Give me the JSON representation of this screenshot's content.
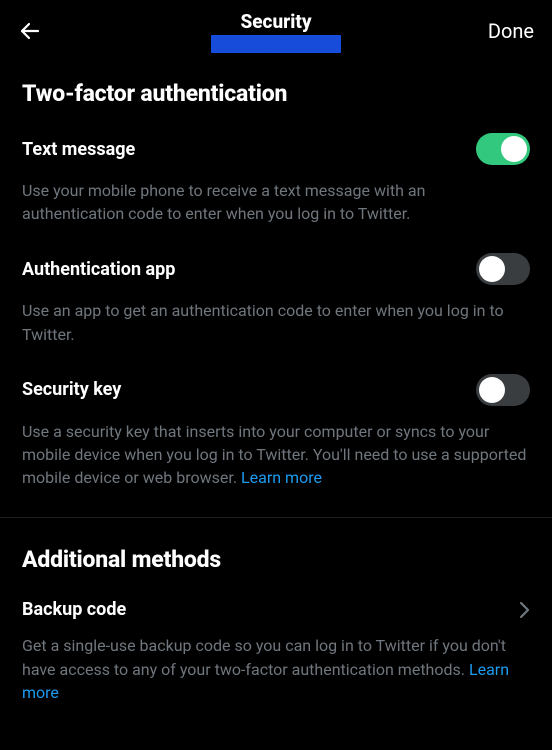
{
  "header": {
    "title": "Security",
    "handle": "@",
    "done": "Done"
  },
  "section1": {
    "title": "Two-factor authentication",
    "items": [
      {
        "title": "Text message",
        "desc": "Use your mobile phone to receive a text message with an authentication code to enter when you log in to Twitter.",
        "on": true
      },
      {
        "title": "Authentication app",
        "desc": "Use an app to get an authentication code to enter when you log in to Twitter.",
        "on": false
      },
      {
        "title": "Security key",
        "desc": "Use a security key that inserts into your computer or syncs to your mobile device when you log in to Twitter. You'll need to use a supported mobile device or web browser. ",
        "learn_more": "Learn more",
        "on": false
      }
    ]
  },
  "section2": {
    "title": "Additional methods",
    "item": {
      "title": "Backup code",
      "desc": "Get a single-use backup code so you can log in to Twitter if you don't have access to any of your two-factor authentication methods. ",
      "learn_more": "Learn more"
    }
  }
}
